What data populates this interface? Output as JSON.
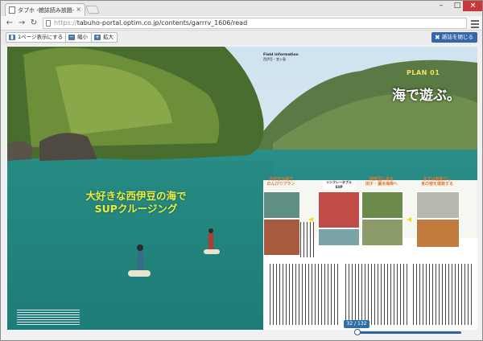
{
  "browser": {
    "tab_title": "タブホ -雑誌読み放題-",
    "tab_close": "×",
    "url_scheme": "https://",
    "url_rest": "tabuho-portal.optim.co.jp/contents/garrrv_1606/read",
    "window_controls": {
      "minimize": "–",
      "maximize": "□",
      "close": "×"
    },
    "nav": {
      "back": "←",
      "forward": "→",
      "reload": "↻"
    }
  },
  "viewer_toolbar": {
    "single_page": "1ページ表示にする",
    "zoom_out": "縮小",
    "zoom_in": "拡大",
    "close_magazine": "雑誌を閉じる",
    "icons": {
      "single": "▮",
      "out": "−",
      "in": "+",
      "close": "✖"
    }
  },
  "magazine": {
    "headline_line1": "大好きな西伊豆の海で",
    "headline_line2": "SUPクルージング",
    "plan_label": "PLAN 01",
    "section_title": "海で遊ぶ。",
    "field_info_title": "Field information",
    "field_info_sub": "西伊豆・堂ヶ島",
    "captions": {
      "c1a": "最初はおっかなびっくり",
      "c1b": "の練習から",
      "c2a": "大好きな海で",
      "c2b": "のんびりプラン",
      "c3a": "西伊豆にある",
      "c3b": "田子・瀬浜海岸へ",
      "c4a": "まずは前乗りし",
      "c4b": "食の宿を堪能する"
    },
    "bubble": "インフレータブルSUP"
  },
  "pager": {
    "counter": "32 / 132",
    "position_fraction": 0.24
  }
}
